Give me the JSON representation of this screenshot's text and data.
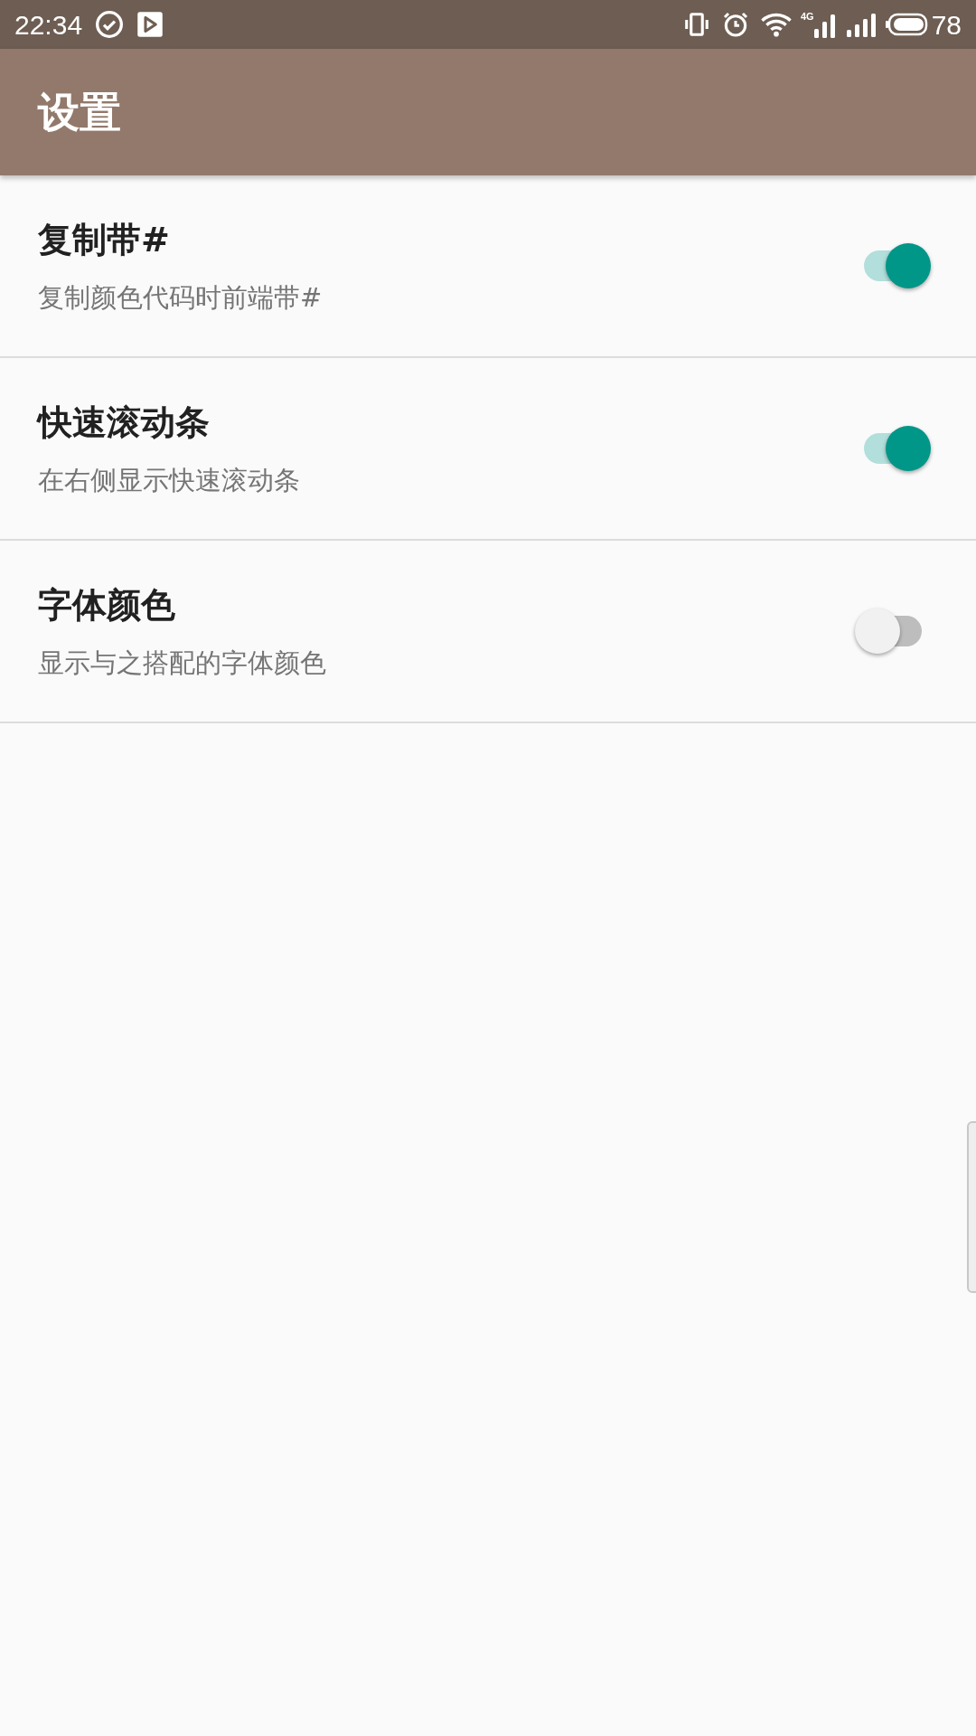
{
  "status_bar": {
    "time": "22:34",
    "network_type": "4G",
    "battery": "78"
  },
  "toolbar": {
    "title": "设置"
  },
  "settings": [
    {
      "title": "复制带#",
      "summary": "复制颜色代码时前端带#",
      "on": true
    },
    {
      "title": "快速滚动条",
      "summary": "在右侧显示快速滚动条",
      "on": true
    },
    {
      "title": "字体颜色",
      "summary": "显示与之搭配的字体颜色",
      "on": false
    }
  ]
}
